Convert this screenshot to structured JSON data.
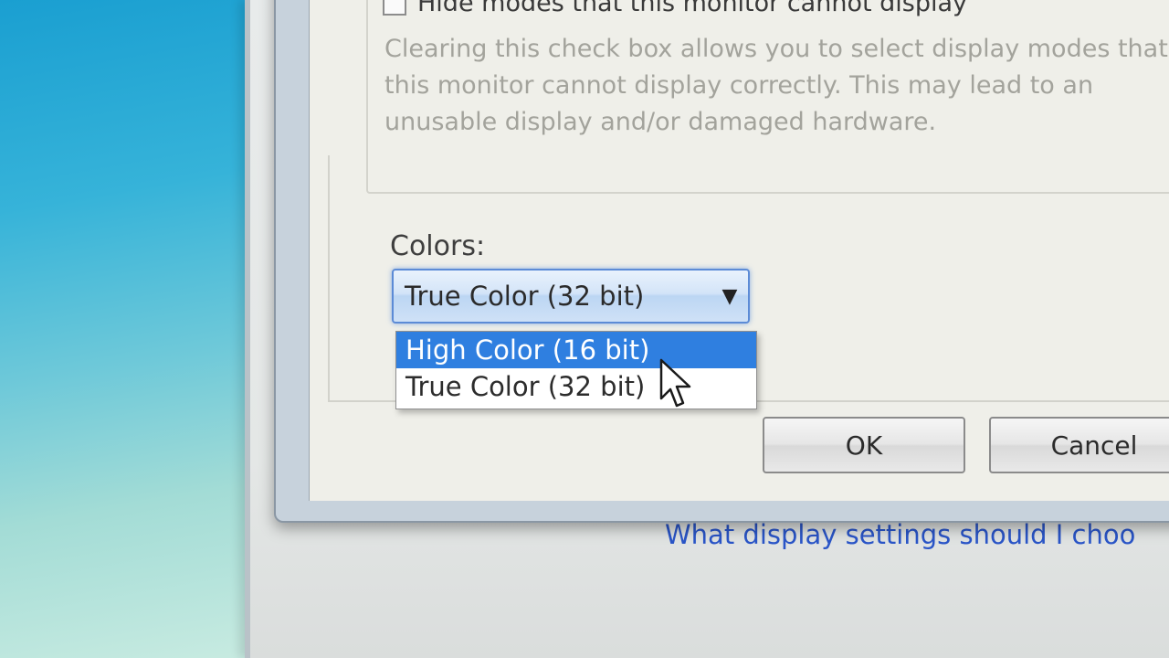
{
  "background_window": {
    "help_link": "What display settings should I choo"
  },
  "dialog": {
    "hide_modes_checkbox_label": "Hide modes that this monitor cannot display",
    "warning_text": "Clearing this check box allows you to select display modes that this monitor cannot display correctly. This may lead to an unusable display and/or damaged hardware.",
    "colors_label": "Colors:",
    "colors_select": {
      "selected": "True Color (32 bit)",
      "options": [
        {
          "label": "High Color (16 bit)",
          "highlighted": true
        },
        {
          "label": "True Color (32 bit)",
          "highlighted": false
        }
      ]
    },
    "ok_label": "OK",
    "cancel_label": "Cancel"
  },
  "colors": {
    "selection_highlight": "#2f7fe0",
    "link": "#2a55c8"
  }
}
